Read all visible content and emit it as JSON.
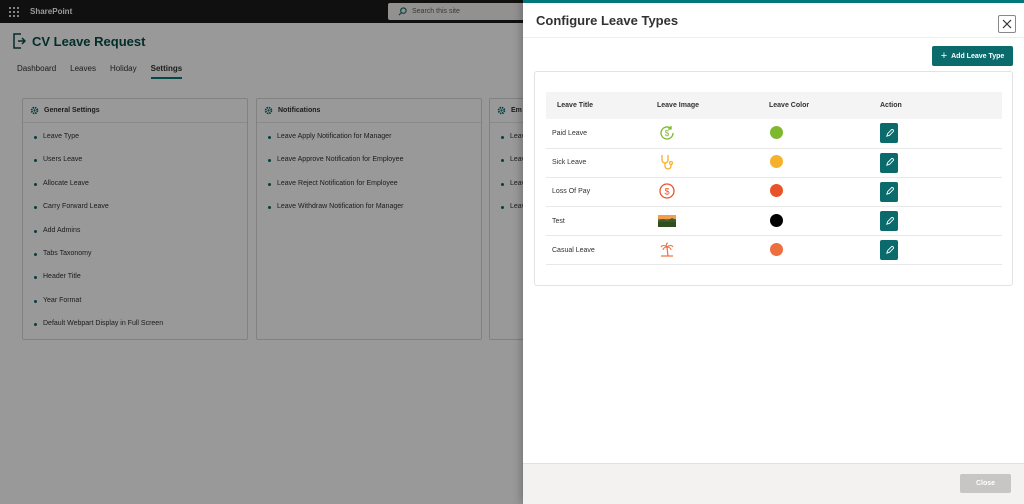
{
  "suite": {
    "app_name": "SharePoint",
    "search_placeholder": "Search this site"
  },
  "app": {
    "title": "CV Leave Request"
  },
  "tabs": [
    {
      "label": "Dashboard"
    },
    {
      "label": "Leaves"
    },
    {
      "label": "Holiday"
    },
    {
      "label": "Settings",
      "active": true
    }
  ],
  "cards": [
    {
      "title": "General Settings",
      "items": [
        "Leave Type",
        "Users Leave",
        "Allocate Leave",
        "Carry Forward Leave",
        "Add Admins",
        "Tabs Taxonomy",
        "Header Title",
        "Year Format",
        "Default Webpart Display in Full Screen"
      ]
    },
    {
      "title": "Notifications",
      "items": [
        "Leave Apply Notification for Manager",
        "Leave Approve Notification for Employee",
        "Leave Reject Notification for Employee",
        "Leave Withdraw Notification for Manager"
      ]
    },
    {
      "title": "Em",
      "items": [
        "Leav",
        "Leav",
        "Leav",
        "Leav"
      ]
    }
  ],
  "panel": {
    "title": "Configure Leave Types",
    "add_label": "Add Leave Type",
    "close_label": "Close",
    "columns": [
      "Leave Title",
      "Leave Image",
      "Leave Color",
      "Action"
    ],
    "rows": [
      {
        "title": "Paid Leave",
        "image_icon": "dollar-cycle-icon",
        "color": "#7fb82e"
      },
      {
        "title": "Sick Leave",
        "image_icon": "stethoscope-icon",
        "color": "#f6b12a"
      },
      {
        "title": "Loss Of Pay",
        "image_icon": "dollar-circle-icon",
        "color": "#e8542a"
      },
      {
        "title": "Test",
        "image_icon": "landscape-photo-icon",
        "color": "#000000"
      },
      {
        "title": "Casual Leave",
        "image_icon": "palm-tree-icon",
        "color": "#ee6f3e"
      }
    ]
  },
  "colors": {
    "accent": "#0b6a6b",
    "title_teal": "#044d46"
  }
}
